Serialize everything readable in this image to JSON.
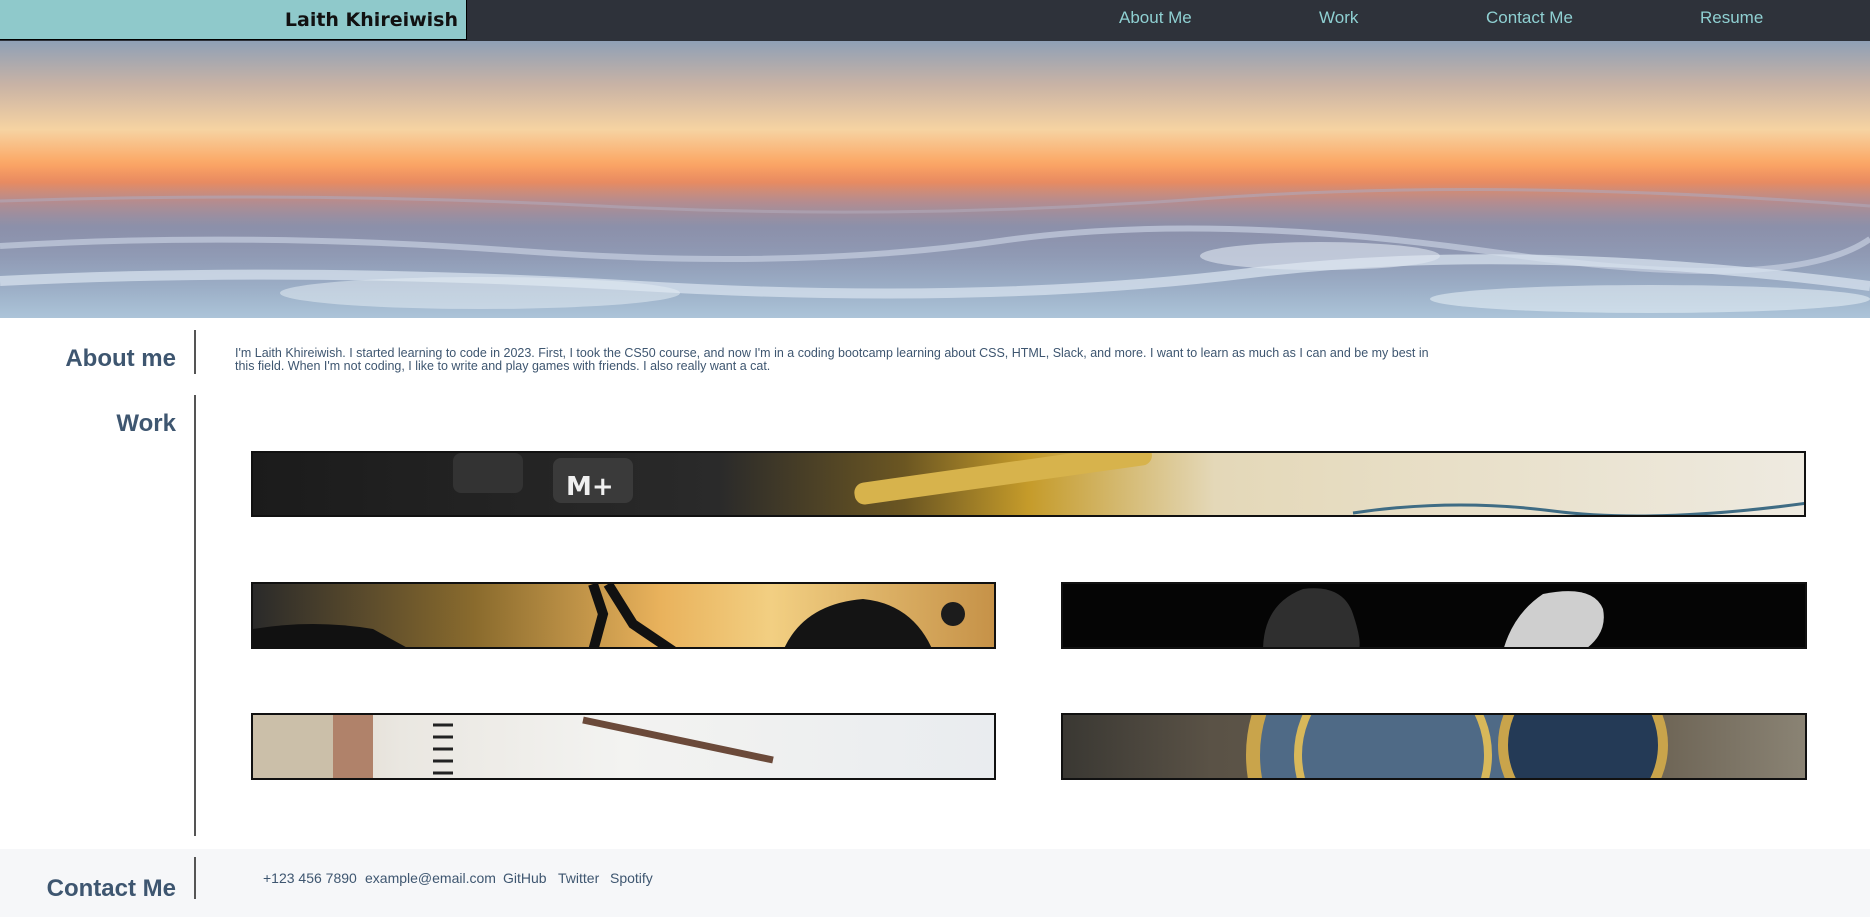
{
  "header": {
    "brand": "Laith Khireiwish",
    "nav": [
      {
        "label": "About Me"
      },
      {
        "label": "Work"
      },
      {
        "label": "Contact Me"
      },
      {
        "label": "Resume"
      }
    ]
  },
  "about": {
    "title": "About me",
    "text": "I'm Laith Khireiwish. I started learning to code in 2023. First, I took the CS50 course, and now I'm in a coding bootcamp learning about CSS, HTML, Slack, and more. I want to learn as much as I can and be my best in this field. When I'm not coding, I like to write and play games with friends. I also really want a cat."
  },
  "work": {
    "title": "Work",
    "projects": [
      {
        "image": "calculator-pen-notebook"
      },
      {
        "image": "silhouette-runner-sunset"
      },
      {
        "image": "chess-knights"
      },
      {
        "image": "notebook-pen"
      },
      {
        "image": "astronomical-clock"
      }
    ]
  },
  "contact": {
    "title": "Contact Me",
    "phone": "+123 456 7890",
    "email": "example@email.com",
    "links": [
      "GitHub",
      "Twitter",
      "Spotify"
    ]
  },
  "colors": {
    "nav_bg": "#2e323a",
    "brand_bg": "#8fc9cb",
    "nav_link": "#8fd0d2",
    "heading": "#3e5670",
    "footer_bg": "#f6f7f9"
  }
}
